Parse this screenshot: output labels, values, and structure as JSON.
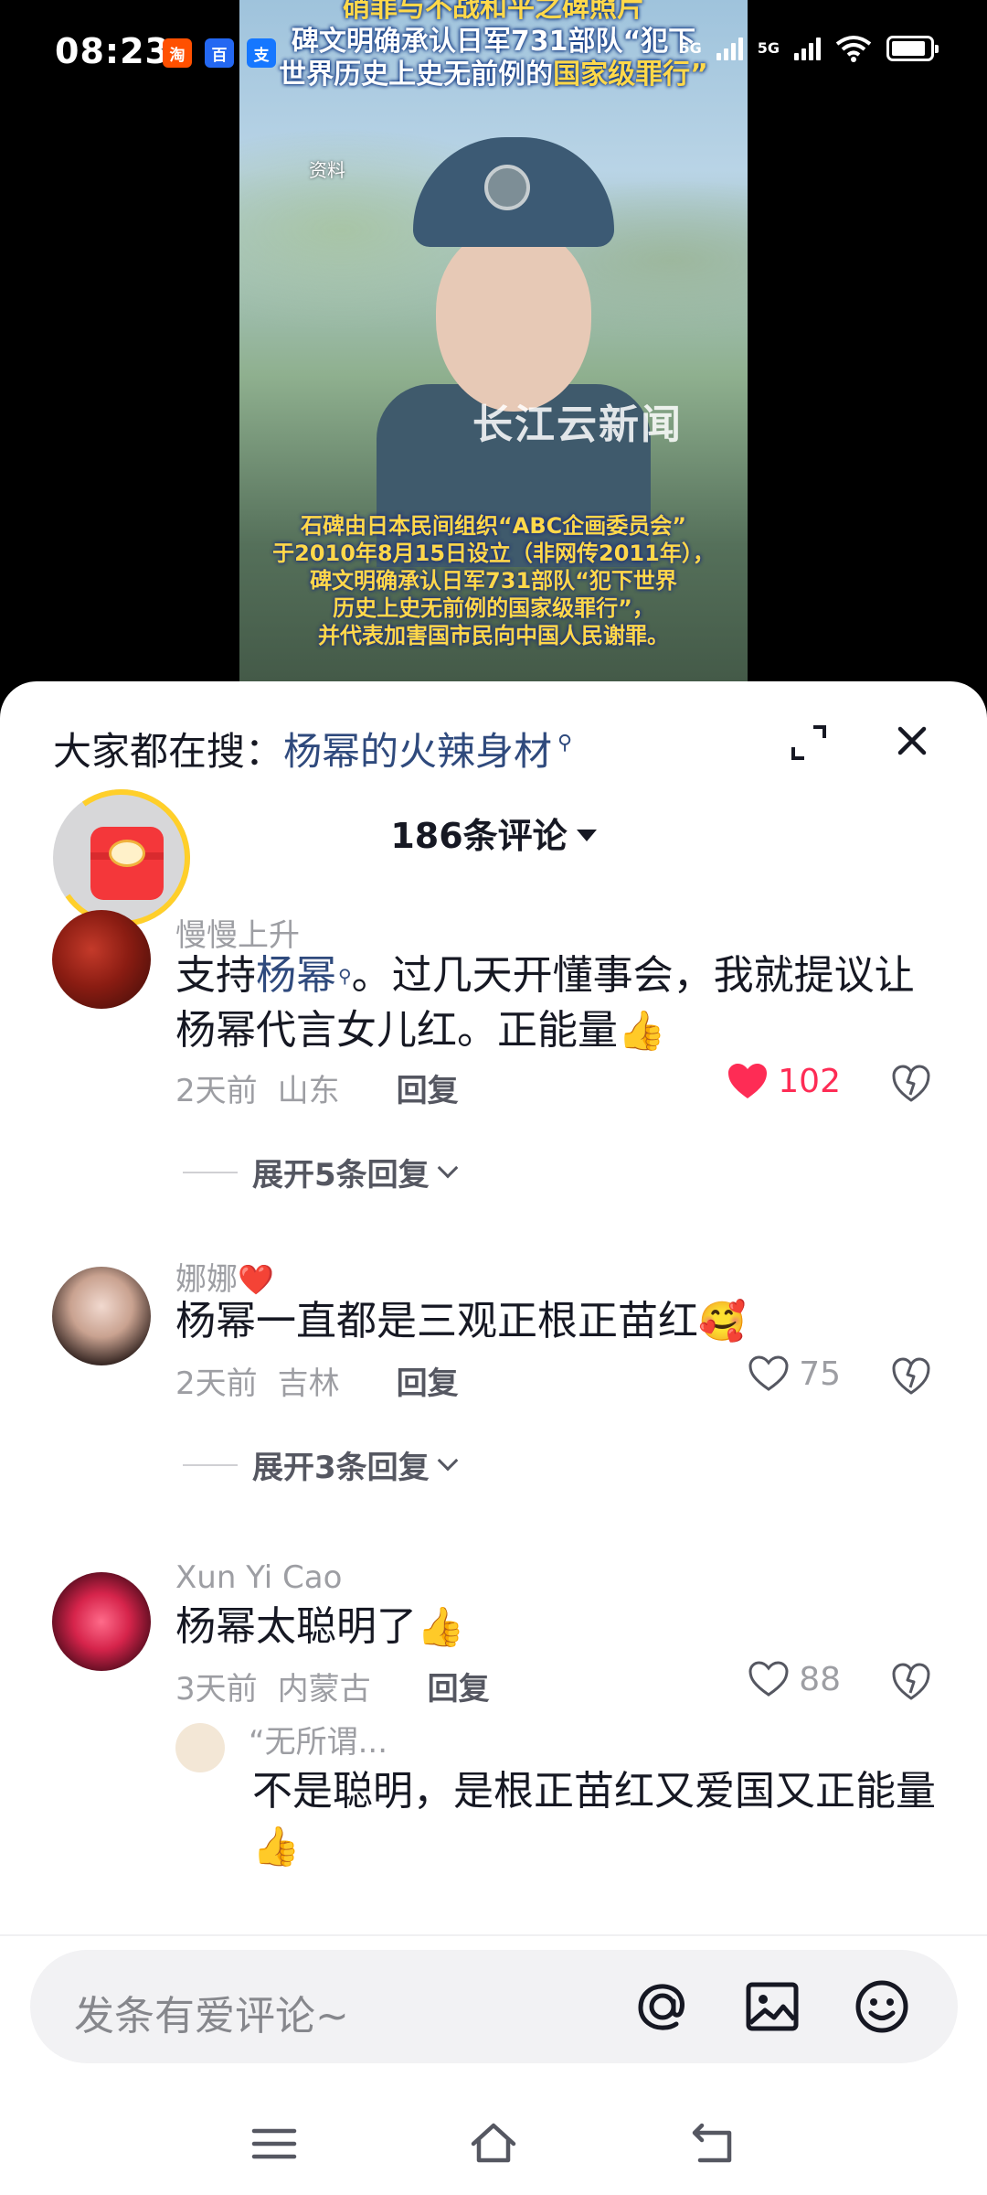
{
  "status_bar": {
    "time": "08:23",
    "network_1": "5G",
    "network_2": "5G",
    "apps": [
      "淘",
      "百",
      "支"
    ]
  },
  "video": {
    "caption_top_line0": "硝罪与不战和平之碑照片",
    "caption_top_line1": "碑文明确承认日军731部队“犯下",
    "caption_top_line2_prefix": "世界历史上史无前例的",
    "caption_top_line2_highlight": "国家级罪行”",
    "source_label": "资料",
    "watermark": "长江云新闻",
    "caption_bottom": [
      "石碑由日本民间组织“ABC企画委员会”",
      "于2010年8月15日设立（非网传2011年），",
      "碑文明确承认日军731部队“犯下世界",
      "历史上史无前例的国家级罪行”，",
      "并代表加害国市民向中国人民谢罪。"
    ]
  },
  "sheet": {
    "hot_search_label": "大家都在搜：",
    "hot_search_term": "杨幂的火辣身材",
    "comment_count": "186条评论"
  },
  "comments": [
    {
      "user": "慢慢上升",
      "text_prefix": "支持",
      "text_keyword": "杨幂",
      "text_rest": "。过几天开懂事会，我就提议让杨幂代言女儿红。正能量",
      "emoji": "👍",
      "time": "2天前",
      "location": "山东",
      "reply_label": "回复",
      "likes": "102",
      "liked": true,
      "expand_label": "展开5条回复"
    },
    {
      "user": "娜娜",
      "user_emoji": "❤️",
      "text": "杨幂一直都是三观正根正苗红",
      "emoji": "🥰",
      "time": "2天前",
      "location": "吉林",
      "reply_label": "回复",
      "likes": "75",
      "liked": false,
      "expand_label": "展开3条回复"
    },
    {
      "user": "Xun Yi Cao",
      "text": "杨幂太聪明了",
      "emoji": "👍",
      "time": "3天前",
      "location": "内蒙古",
      "reply_label": "回复",
      "likes": "88",
      "liked": false
    }
  ],
  "sub_reply": {
    "user": "“无所谓...",
    "text": "不是聪明，是根正苗红又爱国又正能量",
    "emoji": "👍"
  },
  "input": {
    "placeholder": "发条有爱评论~"
  },
  "colors": {
    "like_active": "#fe2c55",
    "keyword_blue": "#2f4a7d",
    "caption_yellow": "#ffd84a"
  }
}
